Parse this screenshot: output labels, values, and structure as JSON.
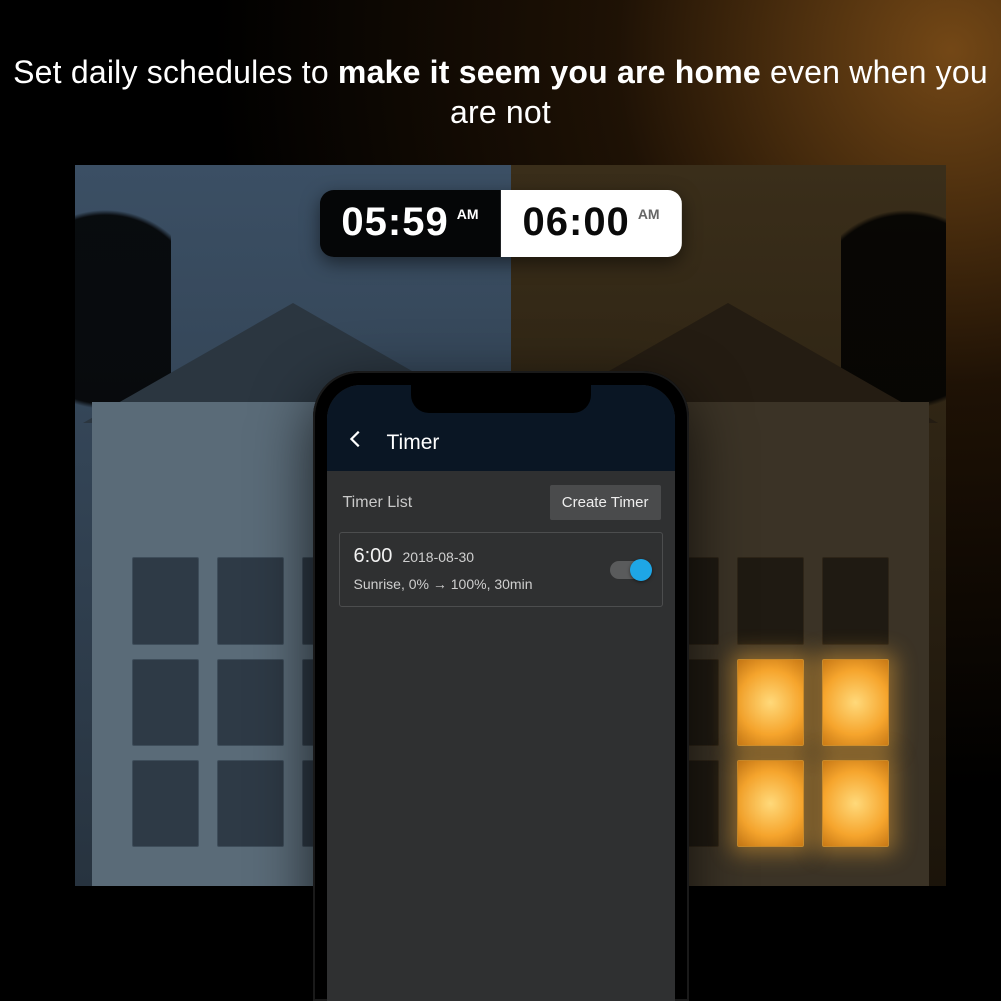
{
  "headline": {
    "part1": "Set daily schedules to ",
    "bold": "make it seem you are home",
    "part2": " even when you are not"
  },
  "time_pill": {
    "left": {
      "time": "05:59",
      "meridiem": "AM"
    },
    "right": {
      "time": "06:00",
      "meridiem": "AM"
    }
  },
  "app": {
    "title": "Timer",
    "section_label": "Timer List",
    "create_button": "Create Timer",
    "timer": {
      "time": "6:00",
      "date": "2018-08-30",
      "description": "Sunrise, 0% → 100%, 30min",
      "enabled": true
    }
  },
  "colors": {
    "accent": "#1ea6e6",
    "appbar": "#0a1624",
    "screen_bg": "#2f3031"
  }
}
